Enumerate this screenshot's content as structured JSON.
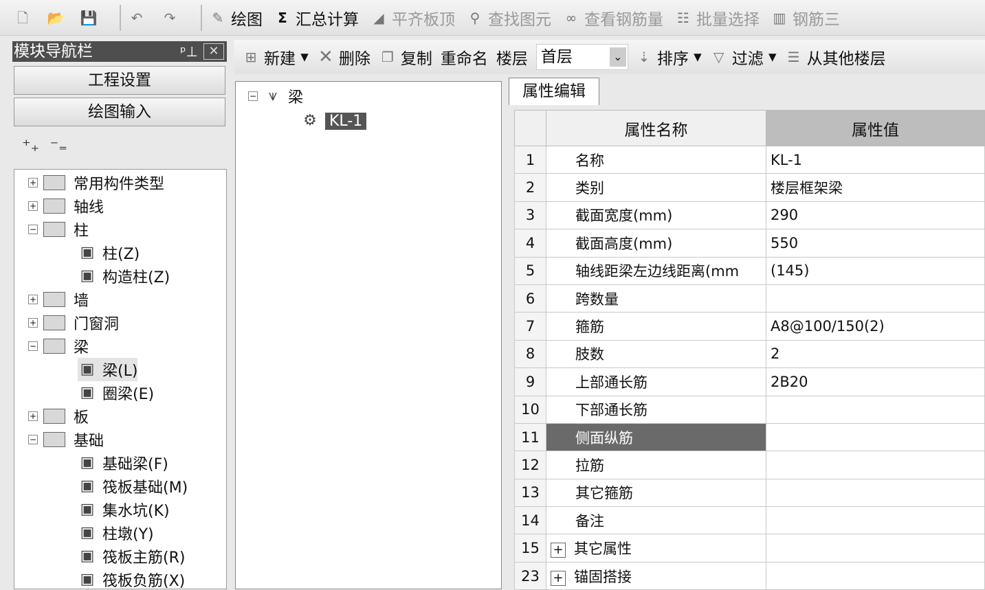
{
  "toolbar": {
    "items": [
      {
        "icon": "new-file-icon",
        "label": ""
      },
      {
        "icon": "open-folder-icon",
        "label": ""
      },
      {
        "icon": "save-icon",
        "label": ""
      },
      {
        "icon": "undo-icon",
        "label": ""
      },
      {
        "icon": "redo-icon",
        "label": ""
      },
      {
        "icon": "draw-icon",
        "label": "绘图",
        "disabled": false
      },
      {
        "icon": "sigma-icon",
        "label": "汇总计算",
        "disabled": false
      },
      {
        "icon": "align-icon",
        "label": "平齐板顶",
        "disabled": true
      },
      {
        "icon": "binoculars-icon",
        "label": "查找图元",
        "disabled": true
      },
      {
        "icon": "glasses-icon",
        "label": "查看钢筋量",
        "disabled": true
      },
      {
        "icon": "batch-select-icon",
        "label": "批量选择",
        "disabled": true
      },
      {
        "icon": "rebar-icon",
        "label": "钢筋三",
        "disabled": true
      }
    ]
  },
  "nav": {
    "title": "模块导航栏",
    "project_settings": "工程设置",
    "drawing_input": "绘图输入",
    "tree": [
      {
        "label": "常用构件类型",
        "level": 0,
        "exp": "+"
      },
      {
        "label": "轴线",
        "level": 0,
        "exp": "+"
      },
      {
        "label": "柱",
        "level": 0,
        "exp": "-"
      },
      {
        "label": "柱(Z)",
        "level": 1,
        "icon": "column-icon"
      },
      {
        "label": "构造柱(Z)",
        "level": 1,
        "icon": "construct-column-icon"
      },
      {
        "label": "墙",
        "level": 0,
        "exp": "+"
      },
      {
        "label": "门窗洞",
        "level": 0,
        "exp": "+"
      },
      {
        "label": "梁",
        "level": 0,
        "exp": "-"
      },
      {
        "label": "梁(L)",
        "level": 1,
        "icon": "beam-icon",
        "selected": true
      },
      {
        "label": "圈梁(E)",
        "level": 1,
        "icon": "ring-beam-icon"
      },
      {
        "label": "板",
        "level": 0,
        "exp": "+"
      },
      {
        "label": "基础",
        "level": 0,
        "exp": "-"
      },
      {
        "label": "基础梁(F)",
        "level": 1,
        "icon": "foundation-beam-icon"
      },
      {
        "label": "筏板基础(M)",
        "level": 1,
        "icon": "raft-icon"
      },
      {
        "label": "集水坑(K)",
        "level": 1,
        "icon": "sump-icon"
      },
      {
        "label": "柱墩(Y)",
        "level": 1,
        "icon": "pier-icon"
      },
      {
        "label": "筏板主筋(R)",
        "level": 1,
        "icon": "raft-main-rebar-icon"
      },
      {
        "label": "筏板负筋(X)",
        "level": 1,
        "icon": "raft-neg-rebar-icon"
      }
    ]
  },
  "toolbar2": {
    "new": "新建",
    "delete": "删除",
    "copy": "复制",
    "rename": "重命名",
    "floor_label": "楼层",
    "floor_value": "首层",
    "sort": "排序",
    "filter": "过滤",
    "copy_from": "从其他楼层"
  },
  "component_tree": {
    "root": "梁",
    "child": "KL-1"
  },
  "props": {
    "tab": "属性编辑",
    "col_name": "属性名称",
    "col_value": "属性值",
    "rows": [
      {
        "n": "1",
        "name": "名称",
        "value": "KL-1"
      },
      {
        "n": "2",
        "name": "类别",
        "value": "楼层框架梁"
      },
      {
        "n": "3",
        "name": "截面宽度(mm)",
        "value": "290"
      },
      {
        "n": "4",
        "name": "截面高度(mm)",
        "value": "550"
      },
      {
        "n": "5",
        "name": "轴线距梁左边线距离(mm",
        "value": "(145)"
      },
      {
        "n": "6",
        "name": "跨数量",
        "value": ""
      },
      {
        "n": "7",
        "name": "箍筋",
        "value": "A8@100/150(2)"
      },
      {
        "n": "8",
        "name": "肢数",
        "value": "2"
      },
      {
        "n": "9",
        "name": "上部通长筋",
        "value": "2B20"
      },
      {
        "n": "10",
        "name": "下部通长筋",
        "value": ""
      },
      {
        "n": "11",
        "name": "侧面纵筋",
        "value": "",
        "highlight": true
      },
      {
        "n": "12",
        "name": "拉筋",
        "value": ""
      },
      {
        "n": "13",
        "name": "其它箍筋",
        "value": ""
      },
      {
        "n": "14",
        "name": "备注",
        "value": ""
      },
      {
        "n": "15",
        "name": "其它属性",
        "value": "",
        "expand": true
      },
      {
        "n": "23",
        "name": "锚固搭接",
        "value": "",
        "expand": true
      }
    ]
  }
}
